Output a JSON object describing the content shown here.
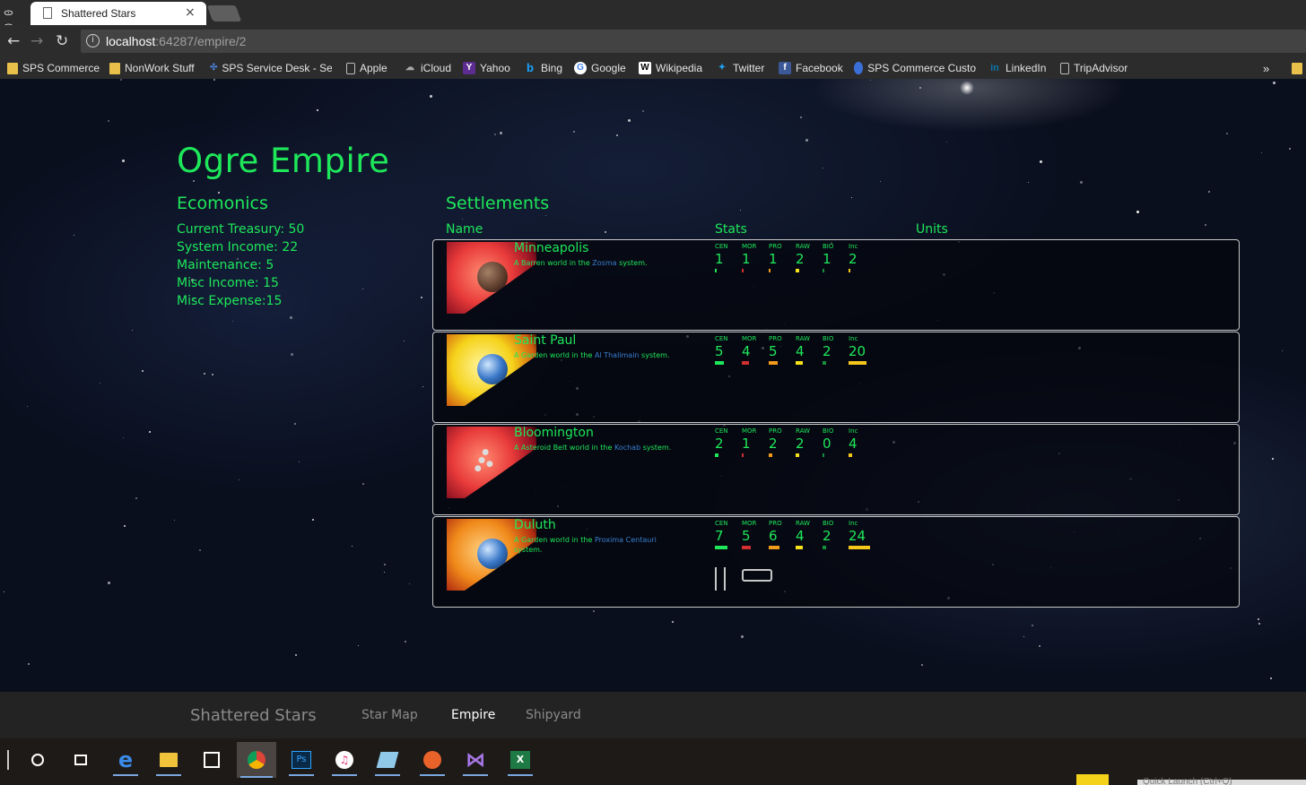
{
  "browser": {
    "tab_title": "Shattered Stars",
    "tab_close": "×",
    "url_host": "localhost",
    "url_rest": ":64287/empire/2",
    "bookmarks": [
      {
        "label": "SPS Commerce",
        "icon": "folder-icon"
      },
      {
        "label": "NonWork Stuff",
        "icon": "folder-icon"
      },
      {
        "label": "SPS Service Desk - Se",
        "icon": "service-desk-icon"
      },
      {
        "label": "Apple",
        "icon": "page-icon"
      },
      {
        "label": "iCloud",
        "icon": "cloud-icon"
      },
      {
        "label": "Yahoo",
        "icon": "yahoo-icon"
      },
      {
        "label": "Bing",
        "icon": "bing-icon"
      },
      {
        "label": "Google",
        "icon": "google-icon"
      },
      {
        "label": "Wikipedia",
        "icon": "wikipedia-icon"
      },
      {
        "label": "Twitter",
        "icon": "twitter-icon"
      },
      {
        "label": "Facebook",
        "icon": "facebook-icon"
      },
      {
        "label": "SPS Commerce Custo",
        "icon": "sps-icon"
      },
      {
        "label": "LinkedIn",
        "icon": "linkedin-icon"
      },
      {
        "label": "TripAdvisor",
        "icon": "page-icon"
      }
    ],
    "more_bookmarks": "»"
  },
  "empire": {
    "title": "Ogre Empire",
    "economics_heading": "Ecomonics",
    "economics": [
      "Current Treasury: 50",
      "System Income: 22",
      "Maintenance: 5",
      "Misc Income: 15",
      "Misc Expense:15"
    ],
    "settlements_heading": "Settlements",
    "col_name": "Name",
    "col_stats": "Stats",
    "col_units": "Units",
    "stat_labels": [
      "CEN",
      "MOR",
      "PRO",
      "RAW",
      "BIO",
      "Inc"
    ],
    "stat_colors": [
      "#1ee85a",
      "#d23030",
      "#f29a1a",
      "#f5e21a",
      "#1ee85a",
      "#f5c71a"
    ],
    "settlements": [
      {
        "name": "Minneapolis",
        "desc_pre": "A Barren world in the ",
        "system": "Zosma",
        "desc_post": " system.",
        "stats": [
          "1",
          "1",
          "1",
          "2",
          "1",
          "2"
        ],
        "stat_values": [
          1,
          1,
          1,
          2,
          1,
          2
        ],
        "planet": "barren",
        "units": []
      },
      {
        "name": "Saint Paul",
        "desc_pre": "A Garden world in the ",
        "system": "Al Thalimain",
        "desc_post": " system.",
        "stats": [
          "5",
          "4",
          "5",
          "4",
          "2",
          "20"
        ],
        "stat_values": [
          5,
          4,
          5,
          4,
          2,
          20
        ],
        "planet": "garden-yellow",
        "units": []
      },
      {
        "name": "Bloomington",
        "desc_pre": "A Asteroid Belt world in the ",
        "system": "Kochab",
        "desc_post": " system.",
        "stats": [
          "2",
          "1",
          "2",
          "2",
          "0",
          "4"
        ],
        "stat_values": [
          2,
          1,
          2,
          2,
          0,
          4
        ],
        "planet": "asteroid",
        "units": []
      },
      {
        "name": "Duluth",
        "desc_pre": "A Garden world in the ",
        "system": "Proxima Centauri",
        "desc_post": " system.",
        "stats": [
          "7",
          "5",
          "6",
          "4",
          "2",
          "24"
        ],
        "stat_values": [
          7,
          5,
          6,
          4,
          2,
          24
        ],
        "planet": "garden-orange",
        "units": [
          "ship-icon",
          "station-icon"
        ]
      }
    ]
  },
  "footer_nav": {
    "brand": "Shattered Stars",
    "links": [
      "Star Map",
      "Empire",
      "Shipyard"
    ],
    "active": "Empire"
  },
  "taskbar": {
    "items": [
      "start-icon",
      "cortana-icon",
      "task-view-icon",
      "edge-icon",
      "file-explorer-icon",
      "store-icon",
      "chrome-icon",
      "photoshop-icon",
      "itunes-icon",
      "app-icon",
      "firefox-like-icon",
      "visual-studio-icon",
      "excel-icon"
    ],
    "quick_launch": "Quick Launch (Ctrl+Q)"
  }
}
